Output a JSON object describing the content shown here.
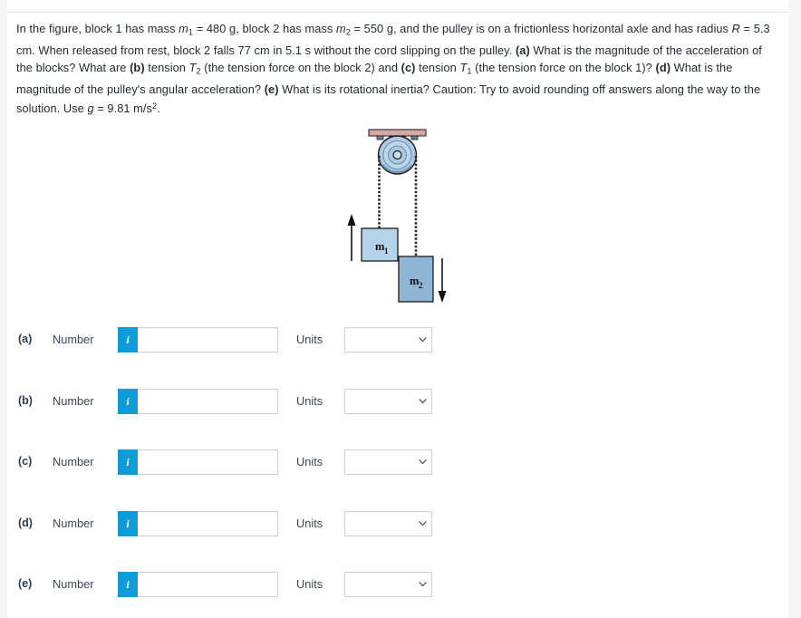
{
  "page": {
    "top_remnant": "physics question header",
    "background_color": "#f7f7f7",
    "card_color": "#ffffff",
    "accent_color": "#0f9bd7"
  },
  "problem": {
    "text_plain": "In the figure, block 1 has mass m1 = 480 g, block 2 has mass m2 = 550 g, and the pulley is on a frictionless horizontal axle and has radius R = 5.3 cm. When released from rest, block 2 falls 77 cm in 5.1 s without the cord slipping on the pulley. (a) What is the magnitude of the acceleration of the blocks? What are (b) tension T2 (the tension force on the block 2) and (c) tension T1 (the tension force on the block 1)? (d) What is the magnitude of the pulley's angular acceleration? (e) What is its rotational inertia? Caution: Try to avoid rounding off answers along the way to the solution. Use g = 9.81 m/s2.",
    "seg": {
      "s1": "In the figure, block 1 has mass ",
      "m1": "m",
      "m1sub": "1",
      "s2": " = 480 g, block 2 has mass ",
      "m2": "m",
      "m2sub": "2",
      "s3": " = 550 g, and the pulley is on a frictionless horizontal axle and has radius ",
      "R": "R",
      "s4": " = 5.3 cm. When released from rest, block 2 falls 77 cm in 5.1 s without the cord slipping on the pulley. ",
      "a_tag": "(a)",
      "s5": " What is the magnitude of the acceleration of the blocks? What are ",
      "b_tag": "(b)",
      "s6": " tension ",
      "T2": "T",
      "T2sub": "2",
      "s7": " (the tension force on the block 2) and ",
      "c_tag": "(c)",
      "s8": " tension ",
      "T1": "T",
      "T1sub": "1",
      "s9": " (the tension force on the block 1)? ",
      "d_tag": "(d)",
      "s10": " What is the magnitude of the pulley's angular acceleration? ",
      "e_tag": "(e)",
      "s11": " What is its rotational inertia? Caution: Try to avoid rounding off answers along the way to the solution. Use ",
      "g": "g",
      "s12": " = 9.81 m/s",
      "gsup": "2",
      "s13": "."
    }
  },
  "figure": {
    "caption": "pulley with two hanging blocks",
    "labels": {
      "m1": "m",
      "m1_sub": "1",
      "m2": "m",
      "m2_sub": "2"
    },
    "colors": {
      "ceiling": "#d4a8a5",
      "pulley_body": "#a8c8e4",
      "pulley_light": "#c4dced",
      "block": "#8fb4d4",
      "block_light": "#b5d3e8",
      "cord": "#2b2b2b",
      "outline": "#1a1a1a"
    },
    "arrows": {
      "m1_direction": "up",
      "m2_direction": "down"
    }
  },
  "answers": {
    "number_label": "Number",
    "units_label": "Units",
    "info_glyph": "i",
    "input_value": "",
    "input_placeholder": "",
    "unit_selected": "",
    "unit_options": [
      ""
    ],
    "rows": [
      {
        "id": "a",
        "label": "(a)"
      },
      {
        "id": "b",
        "label": "(b)"
      },
      {
        "id": "c",
        "label": "(c)"
      },
      {
        "id": "d",
        "label": "(d)"
      },
      {
        "id": "e",
        "label": "(e)"
      }
    ]
  }
}
